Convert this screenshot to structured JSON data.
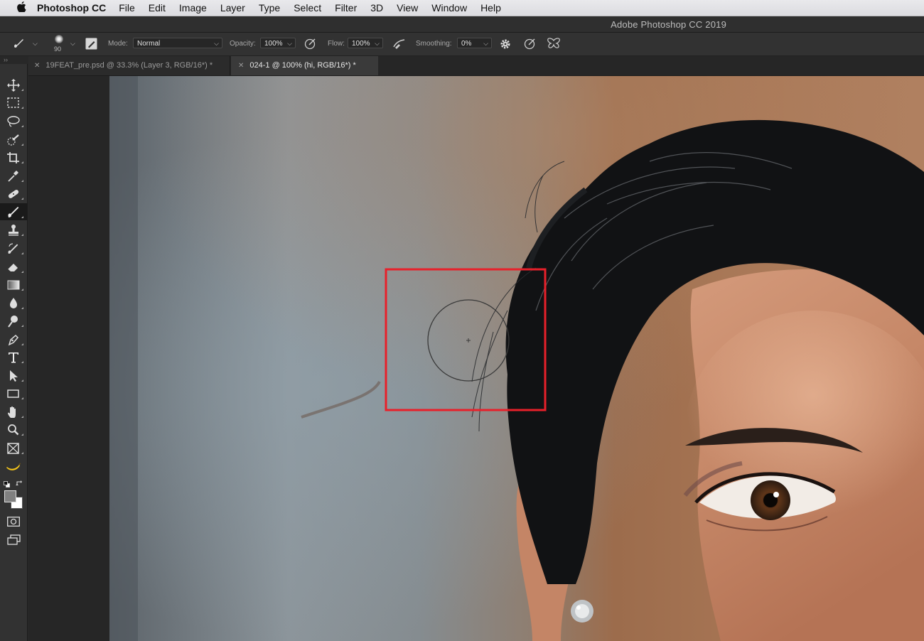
{
  "menubar": {
    "app_name": "Photoshop CC",
    "items": [
      "File",
      "Edit",
      "Image",
      "Layer",
      "Type",
      "Select",
      "Filter",
      "3D",
      "View",
      "Window",
      "Help"
    ]
  },
  "window": {
    "title": "Adobe Photoshop CC 2019"
  },
  "options_bar": {
    "brush_size": "90",
    "mode_label": "Mode:",
    "mode_value": "Normal",
    "opacity_label": "Opacity:",
    "opacity_value": "100%",
    "flow_label": "Flow:",
    "flow_value": "100%",
    "smoothing_label": "Smoothing:",
    "smoothing_value": "0%"
  },
  "tabs": [
    {
      "label": "19FEAT_pre.psd @ 33.3% (Layer 3, RGB/16*) *",
      "active": false
    },
    {
      "label": "024-1 @ 100% (hi, RGB/16*) *",
      "active": true
    }
  ],
  "tools": [
    "move-icon",
    "marquee-icon",
    "lasso-icon",
    "quick-select-icon",
    "crop-icon",
    "eyedropper-icon",
    "healing-icon",
    "brush-icon",
    "clone-stamp-icon",
    "history-brush-icon",
    "eraser-icon",
    "gradient-icon",
    "blur-icon",
    "dodge-icon",
    "pen-icon",
    "type-icon",
    "path-select-icon",
    "rectangle-icon",
    "hand-icon",
    "zoom-icon",
    "frame-icon",
    "banana-icon"
  ],
  "active_tool": "brush-icon",
  "colors": {
    "foreground": "#808080",
    "background": "#ffffff",
    "highlight_box": "#e8202a"
  }
}
